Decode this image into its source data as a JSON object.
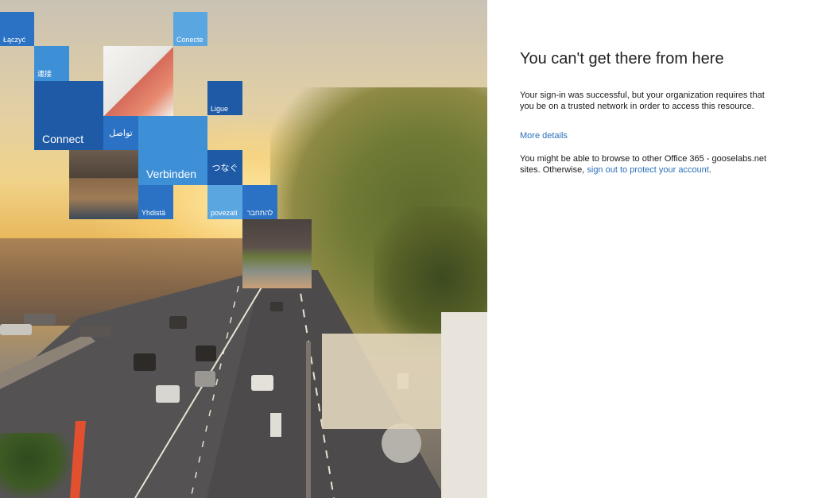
{
  "tiles": {
    "lacz": "Łączyć",
    "conecte": "Conecte",
    "lianjie": "連接",
    "ligue": "Ligue",
    "connect": "Connect",
    "arabic": "تواصل",
    "verbinden": "Verbinden",
    "tsunagu": "つなぐ",
    "yhdista": "Yhdistä",
    "povezati": "povezati",
    "hebrew": "להתחבר"
  },
  "illustration_icons": [
    "person-on-phone-photo",
    "person-with-laptop-photo",
    "person-relaxing-photo",
    "people-at-computer-photo",
    "freeway-cityscape-background"
  ],
  "heading": "You can't get there from here",
  "message": "Your sign-in was successful, but your organization requires that you be on a trusted network in order to access this resource.",
  "more_details": "More details",
  "browse_prefix": "You might be able to browse to other Office 365 - gooselabs.net sites. Otherwise,",
  "signout_link": "sign out to protect your account",
  "browse_suffix": ".",
  "colors": {
    "link": "#2a6fba",
    "tile_dark": "#1e5aa6",
    "tile_light": "#3d8fd6",
    "text": "#1a1a1a"
  }
}
